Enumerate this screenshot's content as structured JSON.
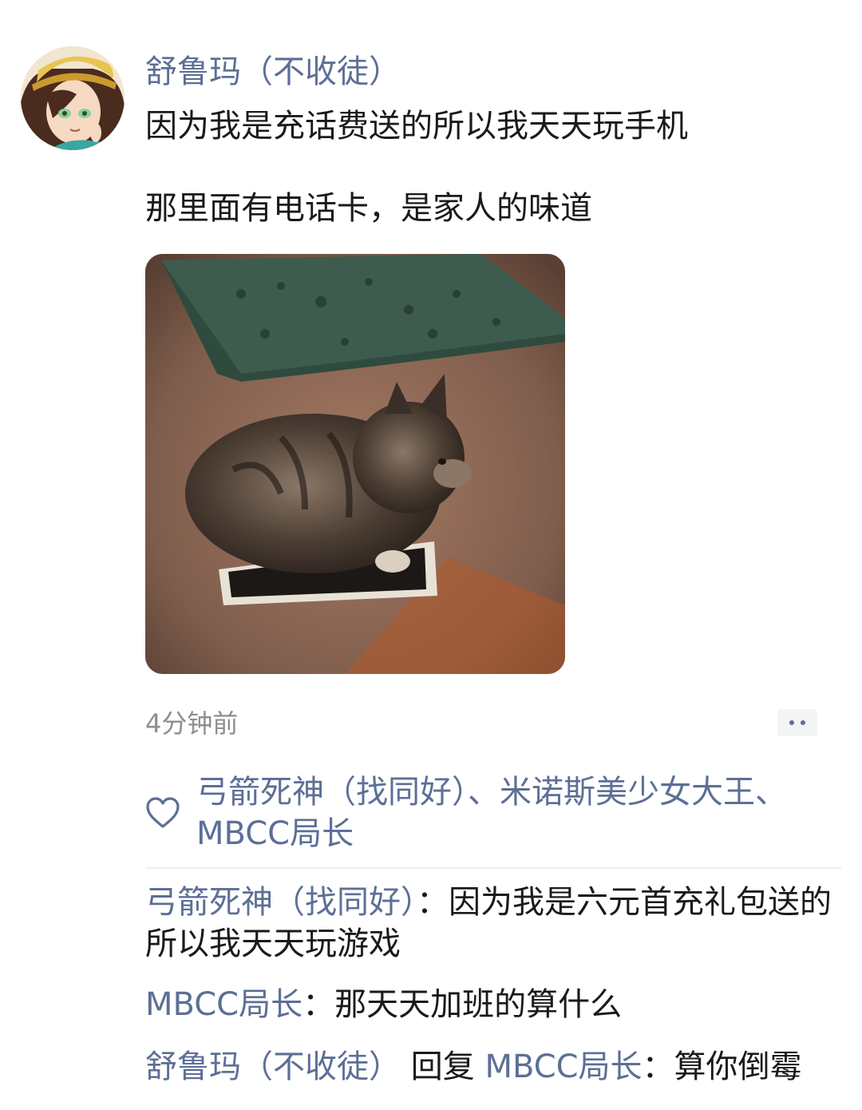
{
  "post": {
    "author": "舒鲁玛（不收徒）",
    "text_line_1": "因为我是充话费送的所以我天天玩手机",
    "text_line_2": "那里面有电话卡，是家人的味道",
    "timestamp": "4分钟前",
    "photo_icon": "kitten-on-phone-photo",
    "avatar_icon": "anime-girl-avatar"
  },
  "likes": {
    "users": [
      "弓箭死神（找同好）",
      "米诺斯美少女大王",
      "MBCC局长"
    ],
    "separator": "、"
  },
  "comments": [
    {
      "name": "弓箭死神（找同好）",
      "colon": "：",
      "text": "因为我是六元首充礼包送的所以我天天玩游戏"
    },
    {
      "name": "MBCC局长",
      "colon": "：",
      "text": "那天天加班的算什么"
    },
    {
      "name": "舒鲁玛（不收徒）",
      "reply_word": "回复",
      "reply_to": "MBCC局长",
      "colon": "：",
      "text": "算你倒霉"
    }
  ],
  "colors": {
    "link": "#5c6f96",
    "text": "#1a1a1a",
    "muted": "#8e8e8e"
  }
}
